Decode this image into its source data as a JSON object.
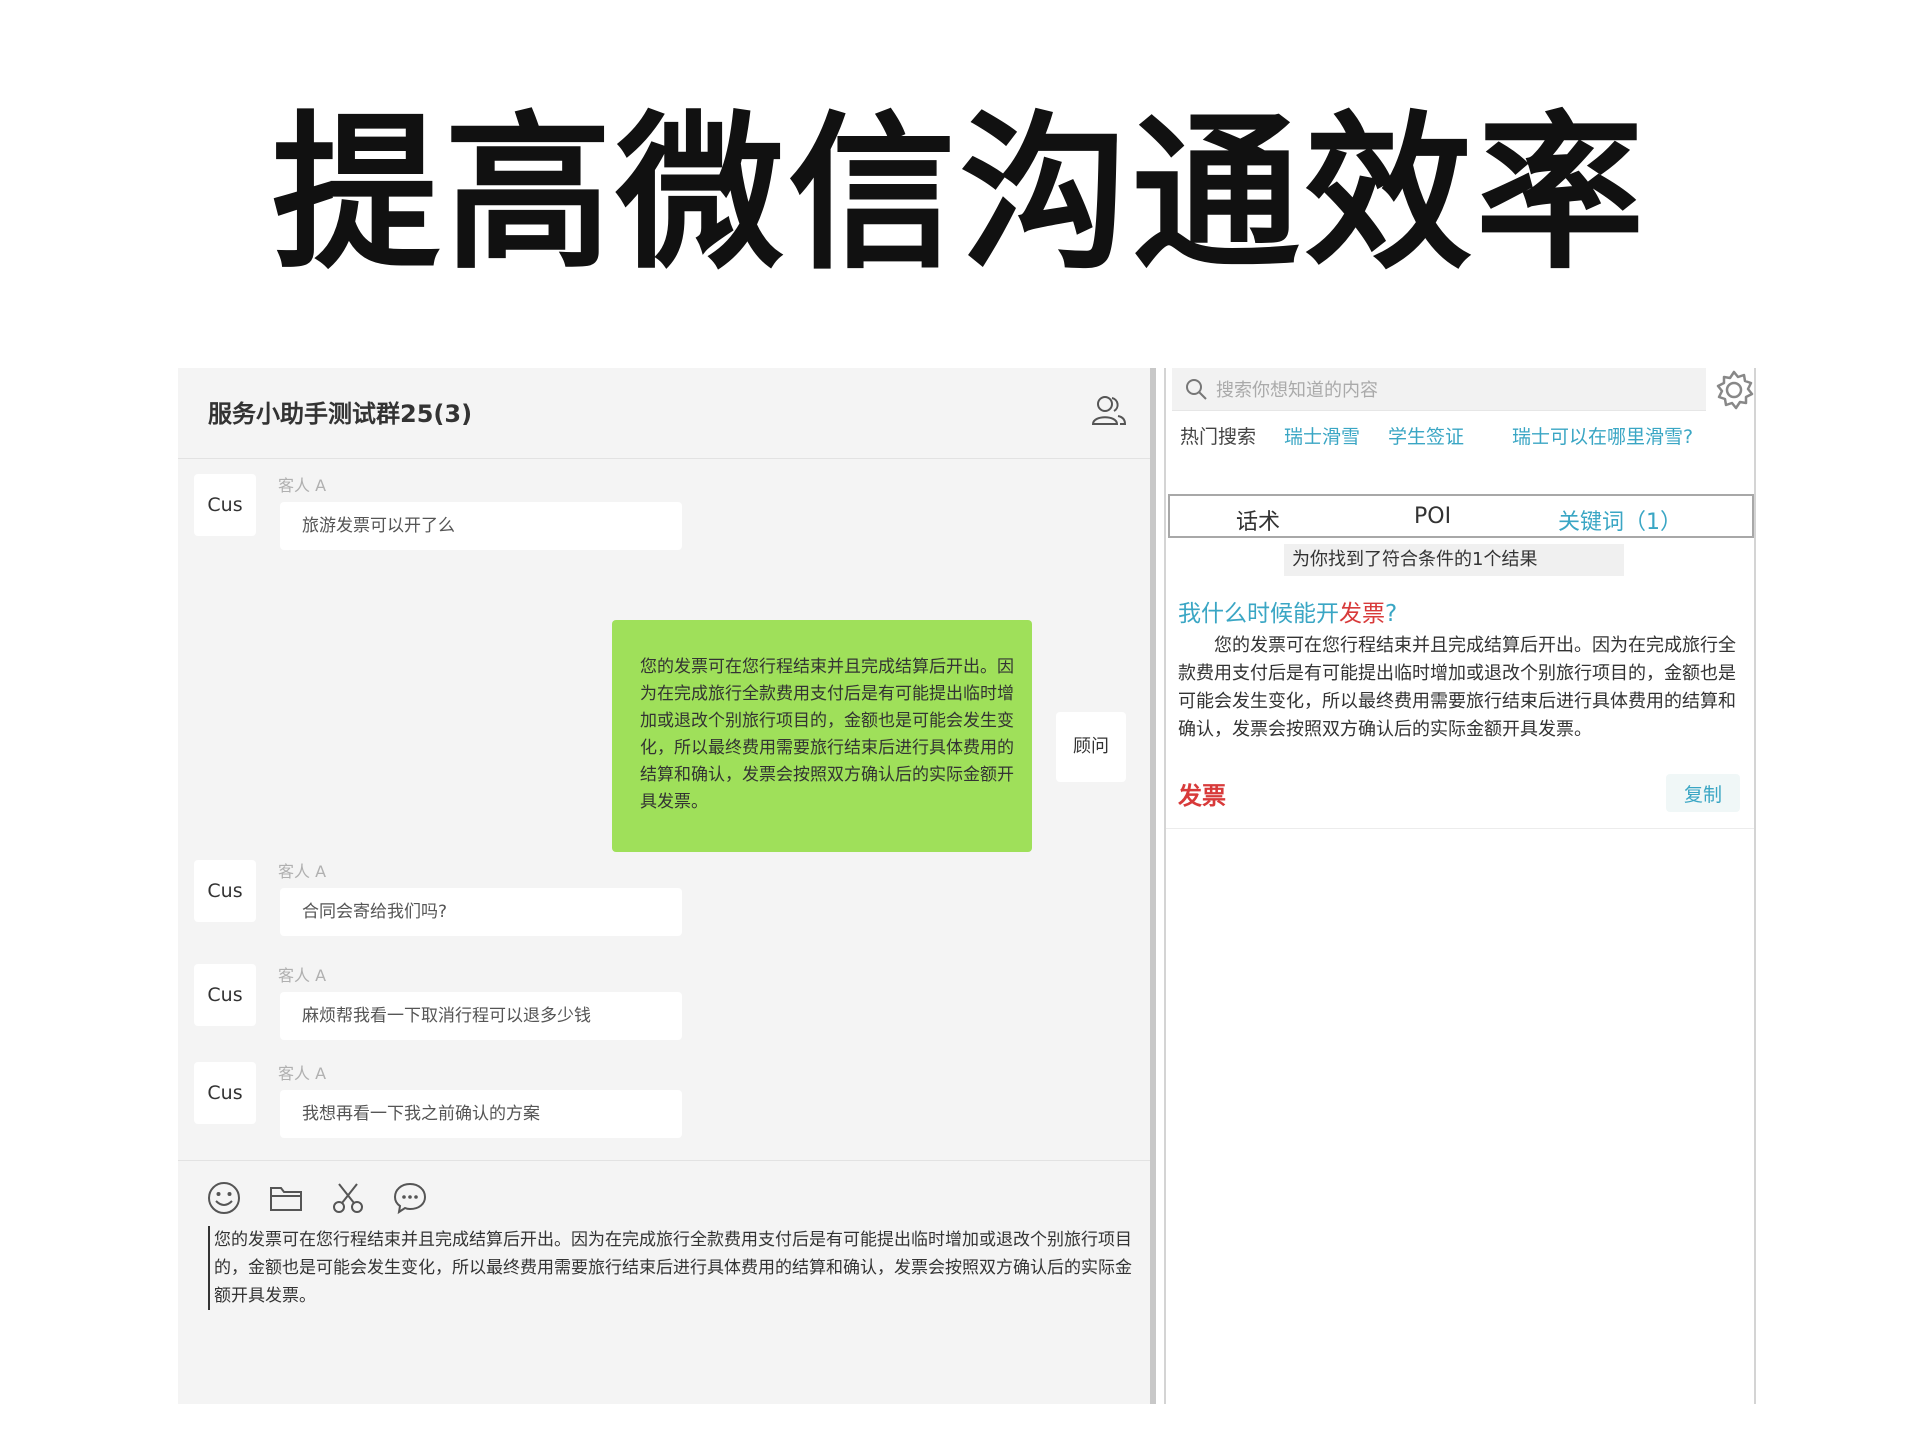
{
  "headline": "提高微信沟通效率",
  "chat": {
    "title": "服务小助手测试群25(3)",
    "messages": [
      {
        "avatar": "Cus",
        "sender": "客人 A",
        "text": "旅游发票可以开了么"
      },
      {
        "avatar": "顾问",
        "text": "您的发票可在您行程结束并且完成结算后开出。因为在完成旅行全款费用支付后是有可能提出临时增加或退改个别旅行项目的，金额也是可能会发生变化，所以最终费用需要旅行结束后进行具体费用的结算和确认，发票会按照双方确认后的实际金额开具发票。"
      },
      {
        "avatar": "Cus",
        "sender": "客人 A",
        "text": "合同会寄给我们吗?"
      },
      {
        "avatar": "Cus",
        "sender": "客人 A",
        "text": "麻烦帮我看一下取消行程可以退多少钱"
      },
      {
        "avatar": "Cus",
        "sender": "客人 A",
        "text": "我想再看一下我之前确认的方案"
      }
    ],
    "draft": "您的发票可在您行程结束并且完成结算后开出。因为在完成旅行全款费用支付后是有可能提出临时增加或退改个别旅行项目的，金额也是可能会发生变化，所以最终费用需要旅行结束后进行具体费用的结算和确认，发票会按照双方确认后的实际金额开具发票。"
  },
  "panel": {
    "search_placeholder": "搜索你想知道的内容",
    "hot_label": "热门搜索",
    "hot_items": [
      "瑞士滑雪",
      "学生签证",
      "瑞士可以在哪里滑雪?"
    ],
    "tabs": [
      "话术",
      "POI",
      "关键词（1）"
    ],
    "result_count": "为你找到了符合条件的1个结果",
    "card": {
      "title_prefix": "我什么时候能开",
      "title_highlight": "发票",
      "title_suffix": "?",
      "body": "您的发票可在您行程结束并且完成结算后开出。因为在完成旅行全款费用支付后是有可能提出临时增加或退改个别旅行项目的，金额也是可能会发生变化，所以最终费用需要旅行结束后进行具体费用的结算和确认，发票会按照双方确认后的实际金额开具发票。",
      "keyword": "发票",
      "copy_label": "复制"
    }
  },
  "colors": {
    "accent": "#3aa6c4",
    "highlight": "#d83a3a",
    "bubble_green": "#9fe05a"
  },
  "icons": [
    "members-icon",
    "emoji-icon",
    "folder-icon",
    "scissors-icon",
    "chat-bubble-icon",
    "search-icon",
    "gear-icon"
  ]
}
